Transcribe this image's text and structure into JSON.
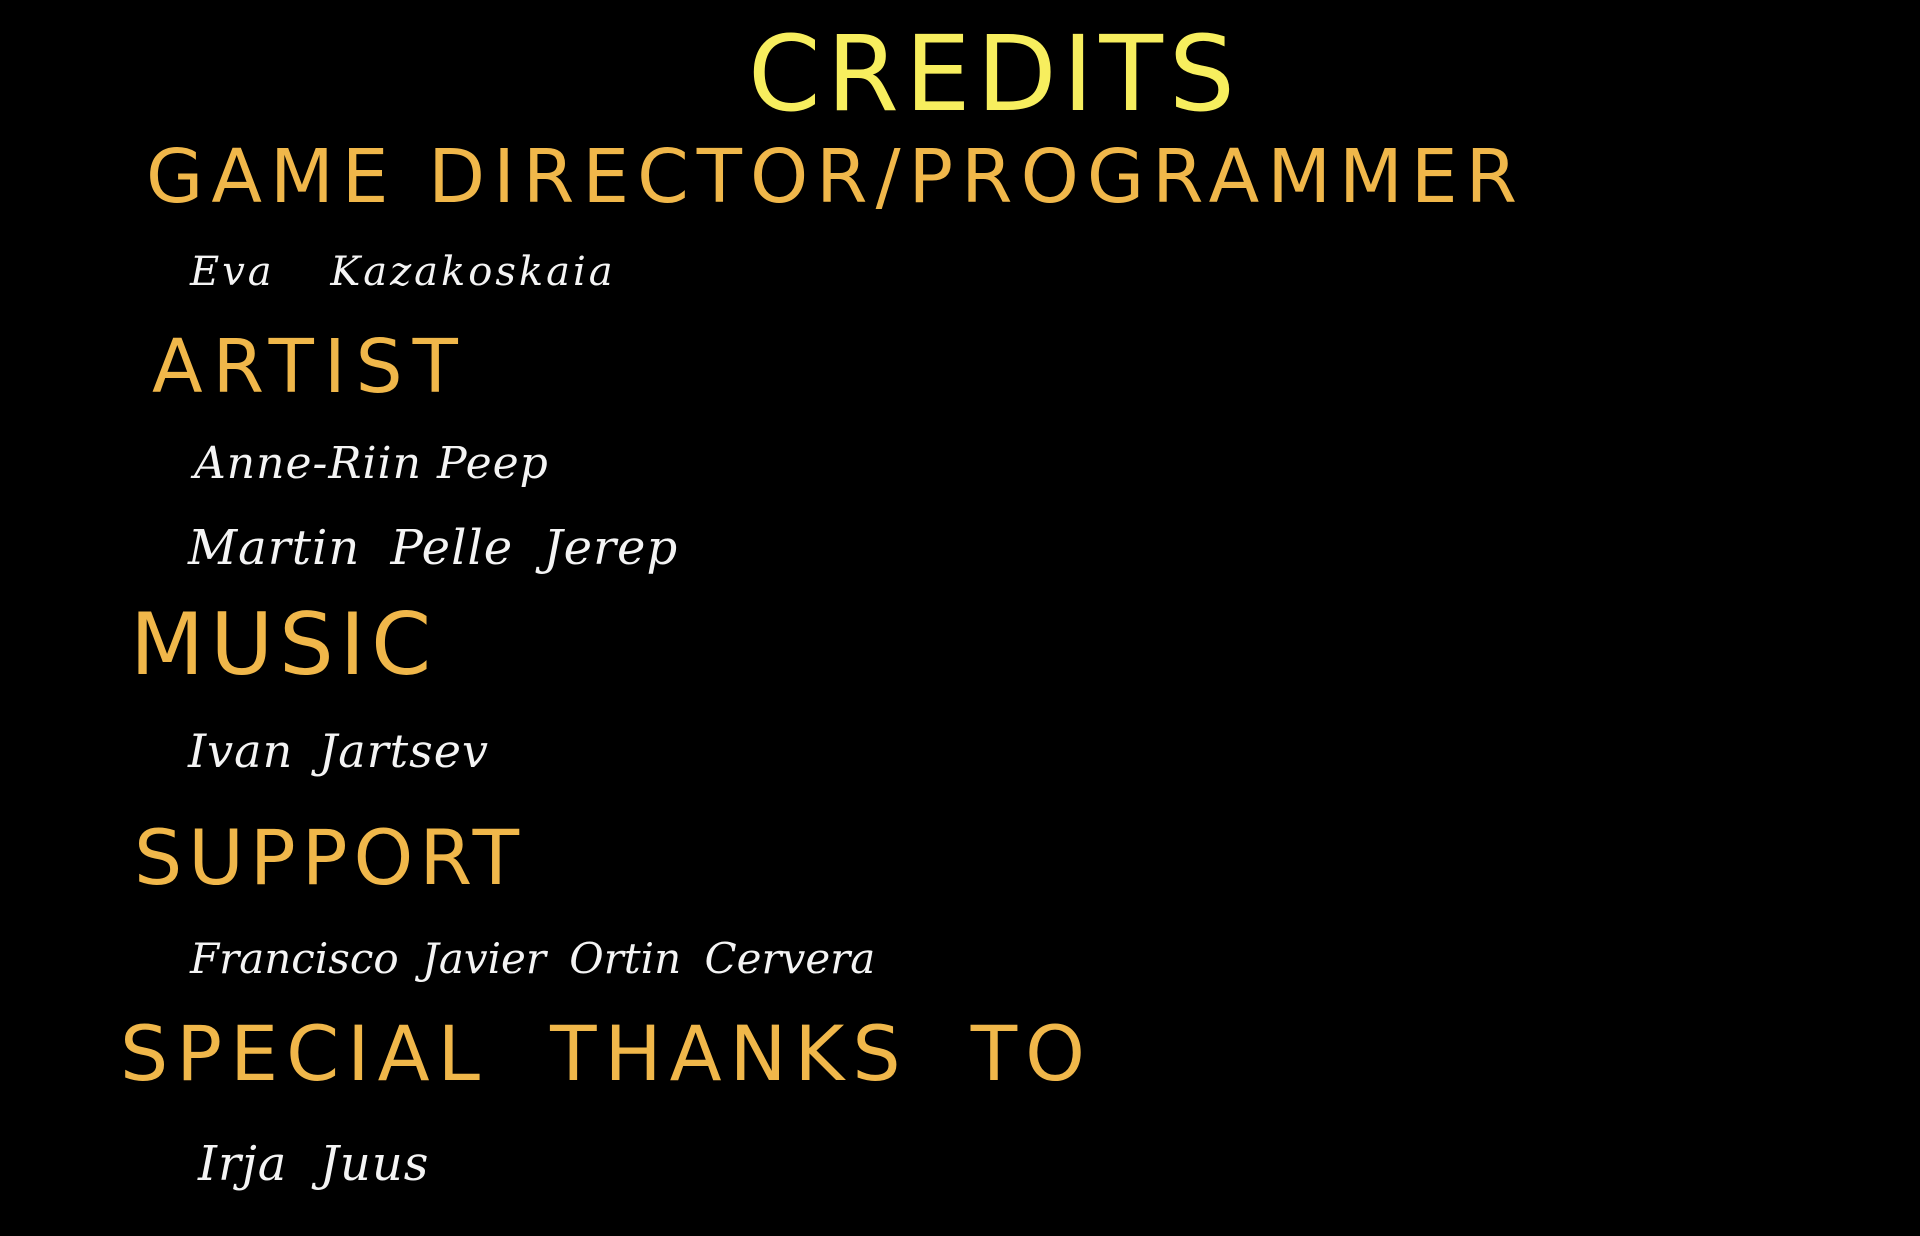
{
  "screen": {
    "title": "CREDITS",
    "colors": {
      "background": "#000000",
      "title": "#f7ee5e",
      "heading": "#f0b74a",
      "name": "#f4f4f4"
    }
  },
  "sections": [
    {
      "heading": "GAME DIRECTOR/PROGRAMMER",
      "names": [
        "Eva Kazakoskaia"
      ]
    },
    {
      "heading": "ARTIST",
      "names": [
        "Anne-Riin Peep",
        "Martin Pelle Jerep"
      ]
    },
    {
      "heading": "MUSIC",
      "names": [
        "Ivan Jartsev"
      ]
    },
    {
      "heading": "SUPPORT",
      "names": [
        "Francisco Javier Ortin Cervera"
      ]
    },
    {
      "heading": "SPECIAL THANKS TO",
      "names": [
        "Irja Juus"
      ]
    }
  ]
}
